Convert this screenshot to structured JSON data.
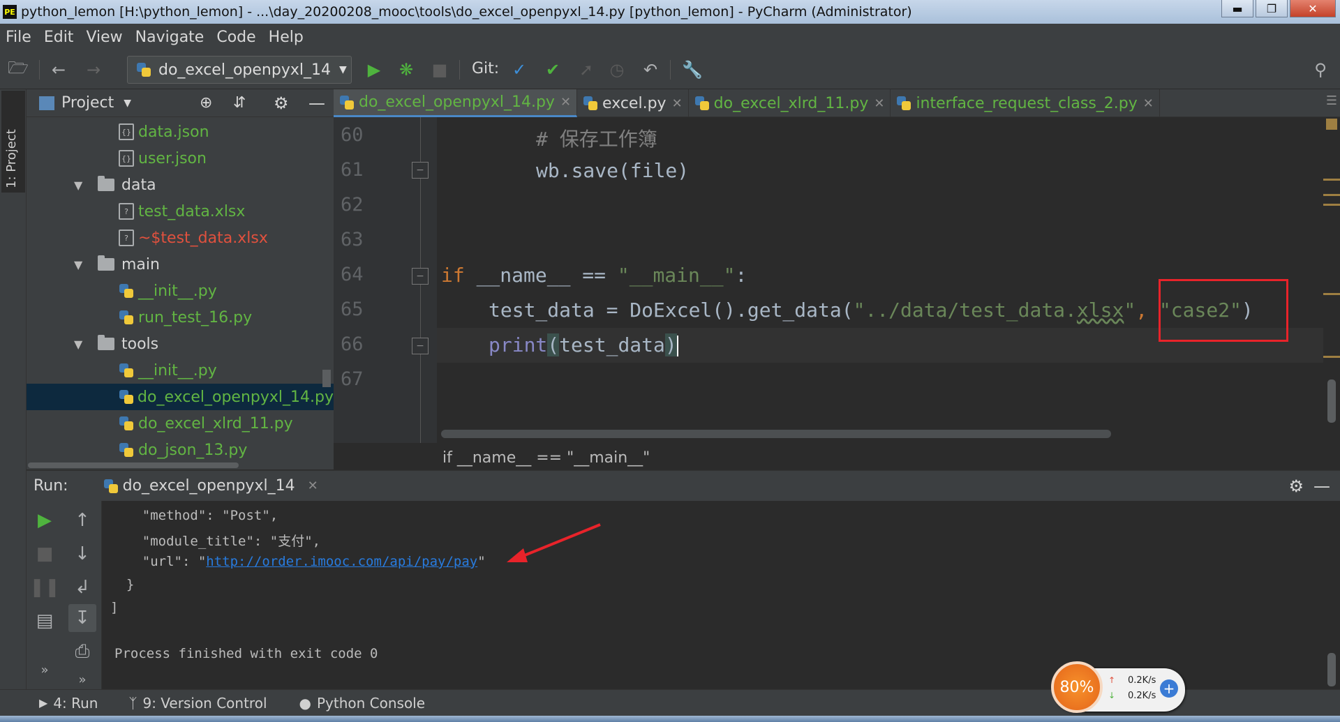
{
  "window": {
    "title": "python_lemon [H:\\python_lemon] - ...\\day_20200208_mooc\\tools\\do_excel_openpyxl_14.py [python_lemon] - PyCharm (Administrator)",
    "app_icon": "PE"
  },
  "menu": [
    "File",
    "Edit",
    "View",
    "Navigate",
    "Code",
    "Help"
  ],
  "toolbar": {
    "run_config": "do_excel_openpyxl_14",
    "git_label": "Git:"
  },
  "left_stripe": {
    "project_tab": "1: Project"
  },
  "project_panel": {
    "title": "Project",
    "tree": [
      {
        "label": "data.json",
        "kind": "json",
        "color": "green"
      },
      {
        "label": "user.json",
        "kind": "json",
        "color": "green"
      },
      {
        "label": "data",
        "kind": "folder",
        "expanded": true
      },
      {
        "label": "test_data.xlsx",
        "kind": "xlsx",
        "color": "green"
      },
      {
        "label": "~$test_data.xlsx",
        "kind": "xlsx",
        "color": "red"
      },
      {
        "label": "main",
        "kind": "folder",
        "expanded": true
      },
      {
        "label": "__init__.py",
        "kind": "py",
        "color": "green"
      },
      {
        "label": "run_test_16.py",
        "kind": "py",
        "color": "green"
      },
      {
        "label": "tools",
        "kind": "folder",
        "expanded": true
      },
      {
        "label": "__init__.py",
        "kind": "py",
        "color": "green"
      },
      {
        "label": "do_excel_openpyxl_14.py",
        "kind": "py",
        "color": "green",
        "selected": true
      },
      {
        "label": "do_excel_xlrd_11.py",
        "kind": "py",
        "color": "green"
      },
      {
        "label": "do_json_13.py",
        "kind": "py",
        "color": "green"
      }
    ]
  },
  "editor_tabs": [
    {
      "label": "do_excel_openpyxl_14.py",
      "active": true,
      "color": "#62b543"
    },
    {
      "label": "excel.py",
      "active": false,
      "color": "#d6d6d6"
    },
    {
      "label": "do_excel_xlrd_11.py",
      "active": false,
      "color": "#62b543"
    },
    {
      "label": "interface_request_class_2.py",
      "active": false,
      "color": "#62b543"
    }
  ],
  "editor": {
    "line_numbers": [
      "60",
      "61",
      "62",
      "63",
      "64",
      "65",
      "66",
      "67"
    ],
    "line60": "# 保存工作簿",
    "line61": "wb.save(file)",
    "line64_kw": "if",
    "line64_rest": " __name__ == ",
    "line64_str": "\"__main__\"",
    "line64_colon": ":",
    "line65_a": "test_data = DoExcel().get_data(",
    "line65_str1a": "\"../data/test_data.",
    "line65_str1b": "xlsx",
    "line65_str1c": "\"",
    "line65_comma": ", ",
    "line65_str2": "\"case2\"",
    "line65_end": ")",
    "line66_fn": "print",
    "line66_open": "(",
    "line66_arg": "test_data",
    "line66_close": ")",
    "breadcrumb": "if __name__ == \"__main__\""
  },
  "run_panel": {
    "label": "Run:",
    "tab": "do_excel_openpyxl_14",
    "console": {
      "l1": "    \"method\": \"Post\",",
      "l2": "    \"module_title\": \"支付\",",
      "l3a": "    \"url\": \"",
      "l3link": "http://order.imooc.com/api/pay/pay",
      "l3b": "\"",
      "l4": "  }",
      "l5": "]",
      "l6": "Process finished with exit code 0"
    }
  },
  "bottom_bar": {
    "run": "4: Run",
    "vcs": "9: Version Control",
    "console": "Python Console"
  },
  "widget": {
    "cpu": "80%",
    "up": "0.2K/s",
    "down": "0.2K/s"
  },
  "colors": {
    "annotation_red": "#e8232a",
    "accent_blue": "#4a88c7",
    "vcs_green": "#62b543"
  }
}
